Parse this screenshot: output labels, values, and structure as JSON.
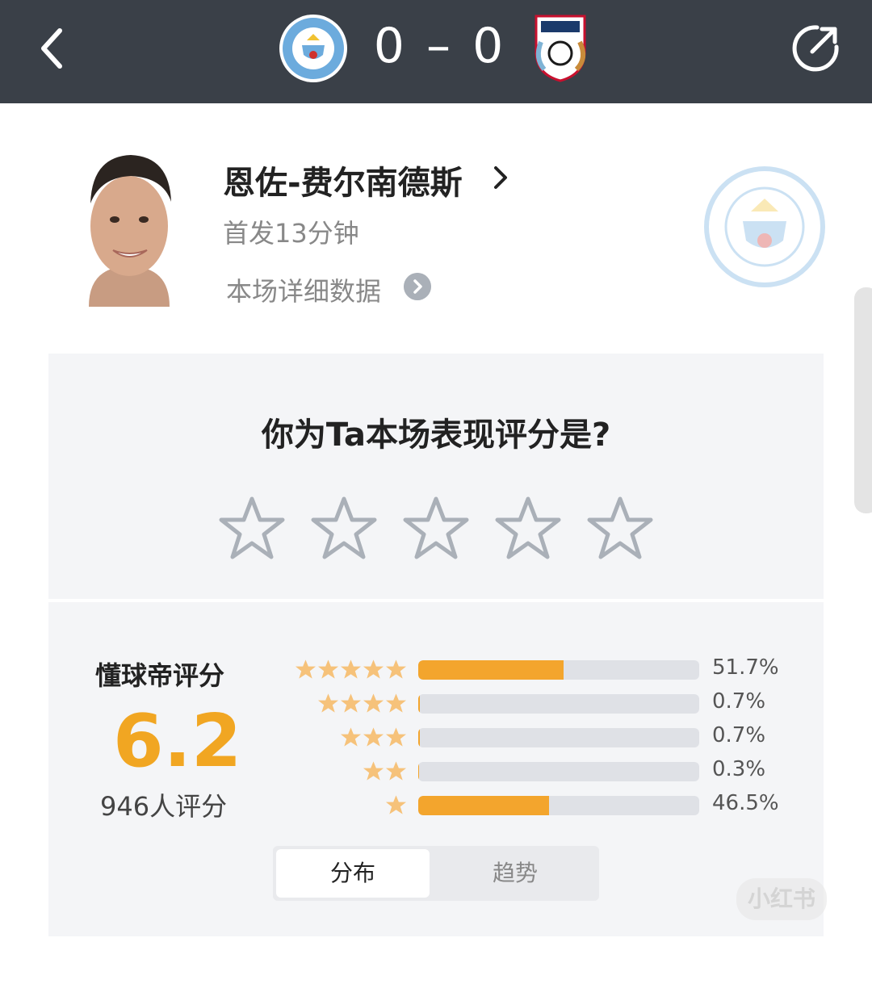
{
  "header": {
    "score_text": "0 – 0",
    "home_team_crest_label": "MANCHESTER CITY",
    "away_team_crest_label": "COVENTRY CITY"
  },
  "player": {
    "name": "恩佐-费尔南德斯",
    "start_info": "首发13分钟",
    "details_link": "本场详细数据",
    "club_crest_label": "MANCHESTER CITY"
  },
  "rating": {
    "question": "你为Ta本场表现评分是?",
    "stars": 5,
    "label": "懂球帝评分",
    "score": "6.2",
    "count_text": "946人评分",
    "distribution": [
      {
        "stars": 5,
        "percent": 51.7,
        "label": "51.7%"
      },
      {
        "stars": 4,
        "percent": 0.7,
        "label": "0.7%"
      },
      {
        "stars": 3,
        "percent": 0.7,
        "label": "0.7%"
      },
      {
        "stars": 2,
        "percent": 0.3,
        "label": "0.3%"
      },
      {
        "stars": 1,
        "percent": 46.5,
        "label": "46.5%"
      }
    ],
    "tabs": [
      "分布",
      "趋势"
    ],
    "active_tab": "分布"
  },
  "watermark": "小红书",
  "colors": {
    "header_bg": "#3a4048",
    "accent": "#f1a622",
    "bar_fill": "#f3a52d",
    "card_bg": "#f4f5f7"
  }
}
